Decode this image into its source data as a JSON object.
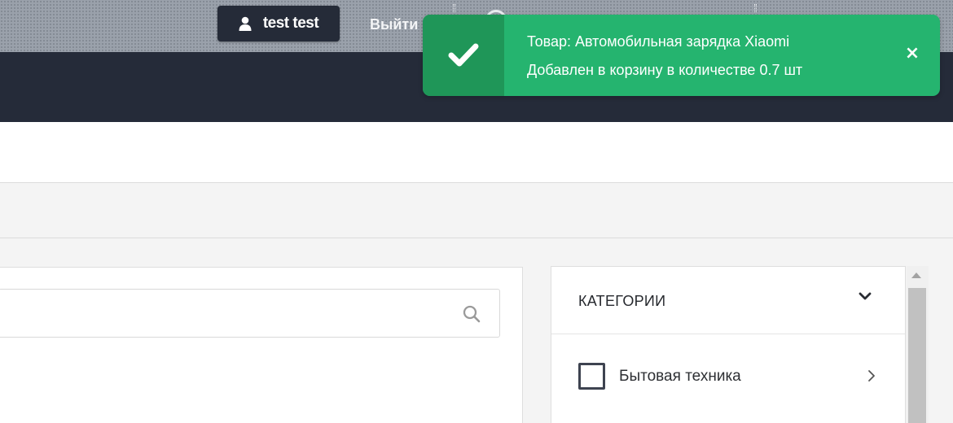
{
  "header": {
    "user_name": "test test",
    "logout_label": "Выйти"
  },
  "search": {
    "value": "",
    "placeholder": ""
  },
  "sidebar": {
    "title": "КАТЕГОРИИ",
    "items": [
      {
        "label": "Бытовая техника",
        "checked": false
      }
    ]
  },
  "toast": {
    "line1": "Товар: Автомобильная зарядка Xiaomi",
    "line2": "Добавлен в корзину в количестве 0.7 шт",
    "close_label": "×"
  },
  "colors": {
    "toast_bg": "#25b46f",
    "toast_icon_bg": "#1f9658",
    "navbar_bg": "#252b39",
    "user_button_bg": "#252b38"
  },
  "icons": [
    "user-icon",
    "check-icon",
    "close-icon",
    "search-icon",
    "chevron-down-icon",
    "chevron-right-icon"
  ]
}
